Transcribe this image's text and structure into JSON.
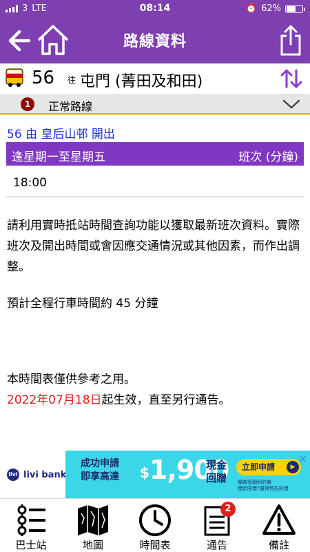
{
  "status": {
    "carrier": "3",
    "network": "LTE",
    "time": "08:14",
    "battery": "62%",
    "battery_level": 0.62
  },
  "header": {
    "title": "路線資料"
  },
  "route": {
    "number": "56",
    "to_label": "往",
    "destination": "屯門 (菁田及和田)"
  },
  "variant": {
    "index": "1",
    "label": "正常路線"
  },
  "timetable": {
    "departure_info": "56 由 皇后山邨 開出",
    "day_label": "逢星期一至星期五",
    "freq_label": "班次 (分鐘)",
    "times": [
      "18:00"
    ]
  },
  "notes": {
    "realtime": "請利用實時抵站時間查詢功能以獲取最新班次資料。實際班次及開出時間或會因應交通情況或其他因素，而作出調整。",
    "journey": "預計全程行車時間約 45 分鐘",
    "reference": "本時間表僅供參考之用。",
    "effective_date": "2022年07月18日",
    "effective_suffix": "起生效，直至另行通告。"
  },
  "ad": {
    "brand": "livi bank",
    "lead_line1": "成功申請",
    "lead_line2": "即享高達",
    "currency": "$",
    "amount": "1,900",
    "cash_line1": "現金",
    "cash_line2": "回贈",
    "cta": "立即申請",
    "fine_line1": "條款受細則約束",
    "fine_line2": "借定唔借?還得到先好借",
    "close": "✕"
  },
  "tabs": [
    {
      "label": "巴士站",
      "icon": "bus-stop-list-icon"
    },
    {
      "label": "地圖",
      "icon": "map-icon"
    },
    {
      "label": "時間表",
      "icon": "clock-icon"
    },
    {
      "label": "通告",
      "icon": "notice-icon",
      "badge": "2"
    },
    {
      "label": "備註",
      "icon": "warning-icon"
    }
  ],
  "colors": {
    "header": "#7e3fb0",
    "table_header": "#8038c2",
    "accent": "#f2a000",
    "link": "#1a2fd6",
    "date_red": "#e21c1c"
  }
}
